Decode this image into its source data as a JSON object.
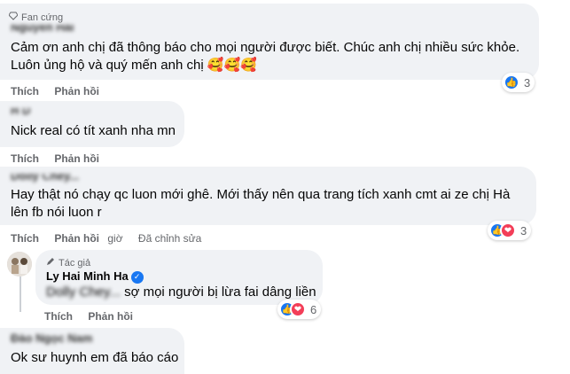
{
  "comments": [
    {
      "badge": "Fan cứng",
      "author": "Nguyễn Hải",
      "text_lines": [
        "Cảm ơn anh chị đã thông báo cho mọi người được biết. Chúc anh chị nhiều sức khỏe.",
        "Luôn ủng hộ và quý mến anh chị"
      ],
      "emojis": [
        "🥰",
        "🥰",
        "🥰"
      ],
      "actions": [
        "Thích",
        "Phản hồi"
      ],
      "reactions": {
        "icons": [
          "like-icon"
        ],
        "count": "3"
      }
    },
    {
      "author": "H D",
      "text_lines": [
        "Nick real có tít xanh nha mn"
      ],
      "actions": [
        "Thích",
        "Phản hồi"
      ]
    },
    {
      "author": "Dolly Chey...",
      "text_lines": [
        "Hay thật nó chạy qc luon mới ghê. Mới thấy nên qua trang tích xanh cmt ai ze chị Hà",
        "lên fb nói luon r"
      ],
      "actions": [
        "Thích",
        "Phản hồi"
      ],
      "time": "giờ",
      "edited": "Đã chỉnh sửa",
      "reactions": {
        "icons": [
          "like-icon",
          "love-icon"
        ],
        "count": "3"
      }
    },
    {
      "badge": "Tác giả",
      "author": "Ly Hai Minh Ha",
      "verified": true,
      "mention": "Dolly Chey...",
      "text": "sợ mọi người bị lừa fai dâng liền",
      "actions": [
        "Thích",
        "Phản hồi"
      ],
      "reactions": {
        "icons": [
          "like-icon",
          "love-icon"
        ],
        "count": "6"
      }
    },
    {
      "author": "Đào Ngọc Nam",
      "text_lines": [
        "Ok sư huynh em đã báo cáo"
      ]
    }
  ],
  "colors": {
    "bubble": "#f0f2f5",
    "like": "#1877f2",
    "love": "#f33e58",
    "muted_text": "#65676b"
  }
}
